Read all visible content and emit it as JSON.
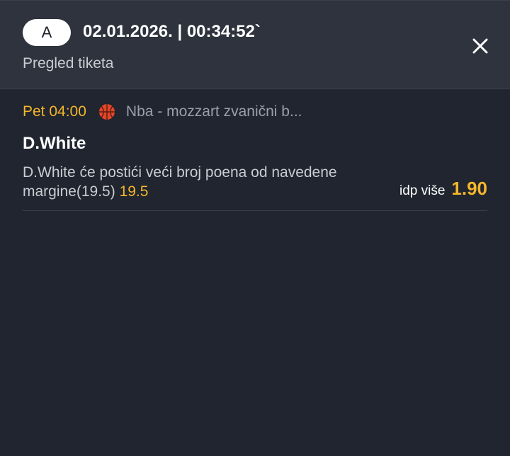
{
  "header": {
    "badge": "A",
    "datetime": "02.01.2026. | 00:34:52`",
    "subtitle": "Pregled tiketa",
    "close_icon": "close-icon"
  },
  "event": {
    "time": "Pet 04:00",
    "sport_icon": "basketball-icon",
    "league": "Nba - mozzart zvanični b...",
    "player": "D.White",
    "description": "D.White će postići veći broj poena od navedene margine(19.5)",
    "line": "19.5",
    "pick_label": "idp više",
    "odds": "1.90"
  },
  "colors": {
    "accent": "#f5b62a",
    "header_bg": "#2e333d",
    "body_bg": "#20252f"
  }
}
